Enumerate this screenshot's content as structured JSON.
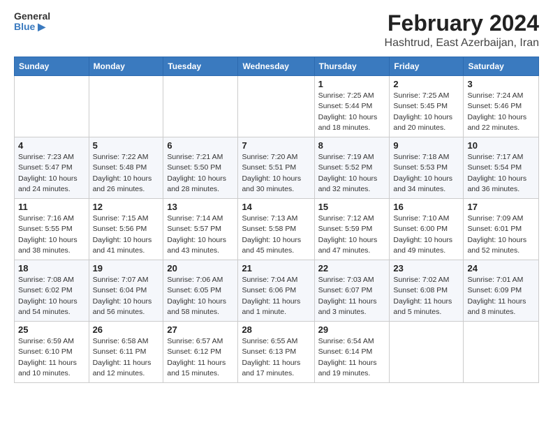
{
  "logo": {
    "general": "General",
    "blue": "Blue"
  },
  "header": {
    "title": "February 2024",
    "subtitle": "Hashtrud, East Azerbaijan, Iran"
  },
  "days_of_week": [
    "Sunday",
    "Monday",
    "Tuesday",
    "Wednesday",
    "Thursday",
    "Friday",
    "Saturday"
  ],
  "weeks": [
    [
      {
        "day": "",
        "detail": ""
      },
      {
        "day": "",
        "detail": ""
      },
      {
        "day": "",
        "detail": ""
      },
      {
        "day": "",
        "detail": ""
      },
      {
        "day": "1",
        "detail": "Sunrise: 7:25 AM\nSunset: 5:44 PM\nDaylight: 10 hours\nand 18 minutes."
      },
      {
        "day": "2",
        "detail": "Sunrise: 7:25 AM\nSunset: 5:45 PM\nDaylight: 10 hours\nand 20 minutes."
      },
      {
        "day": "3",
        "detail": "Sunrise: 7:24 AM\nSunset: 5:46 PM\nDaylight: 10 hours\nand 22 minutes."
      }
    ],
    [
      {
        "day": "4",
        "detail": "Sunrise: 7:23 AM\nSunset: 5:47 PM\nDaylight: 10 hours\nand 24 minutes."
      },
      {
        "day": "5",
        "detail": "Sunrise: 7:22 AM\nSunset: 5:48 PM\nDaylight: 10 hours\nand 26 minutes."
      },
      {
        "day": "6",
        "detail": "Sunrise: 7:21 AM\nSunset: 5:50 PM\nDaylight: 10 hours\nand 28 minutes."
      },
      {
        "day": "7",
        "detail": "Sunrise: 7:20 AM\nSunset: 5:51 PM\nDaylight: 10 hours\nand 30 minutes."
      },
      {
        "day": "8",
        "detail": "Sunrise: 7:19 AM\nSunset: 5:52 PM\nDaylight: 10 hours\nand 32 minutes."
      },
      {
        "day": "9",
        "detail": "Sunrise: 7:18 AM\nSunset: 5:53 PM\nDaylight: 10 hours\nand 34 minutes."
      },
      {
        "day": "10",
        "detail": "Sunrise: 7:17 AM\nSunset: 5:54 PM\nDaylight: 10 hours\nand 36 minutes."
      }
    ],
    [
      {
        "day": "11",
        "detail": "Sunrise: 7:16 AM\nSunset: 5:55 PM\nDaylight: 10 hours\nand 38 minutes."
      },
      {
        "day": "12",
        "detail": "Sunrise: 7:15 AM\nSunset: 5:56 PM\nDaylight: 10 hours\nand 41 minutes."
      },
      {
        "day": "13",
        "detail": "Sunrise: 7:14 AM\nSunset: 5:57 PM\nDaylight: 10 hours\nand 43 minutes."
      },
      {
        "day": "14",
        "detail": "Sunrise: 7:13 AM\nSunset: 5:58 PM\nDaylight: 10 hours\nand 45 minutes."
      },
      {
        "day": "15",
        "detail": "Sunrise: 7:12 AM\nSunset: 5:59 PM\nDaylight: 10 hours\nand 47 minutes."
      },
      {
        "day": "16",
        "detail": "Sunrise: 7:10 AM\nSunset: 6:00 PM\nDaylight: 10 hours\nand 49 minutes."
      },
      {
        "day": "17",
        "detail": "Sunrise: 7:09 AM\nSunset: 6:01 PM\nDaylight: 10 hours\nand 52 minutes."
      }
    ],
    [
      {
        "day": "18",
        "detail": "Sunrise: 7:08 AM\nSunset: 6:02 PM\nDaylight: 10 hours\nand 54 minutes."
      },
      {
        "day": "19",
        "detail": "Sunrise: 7:07 AM\nSunset: 6:04 PM\nDaylight: 10 hours\nand 56 minutes."
      },
      {
        "day": "20",
        "detail": "Sunrise: 7:06 AM\nSunset: 6:05 PM\nDaylight: 10 hours\nand 58 minutes."
      },
      {
        "day": "21",
        "detail": "Sunrise: 7:04 AM\nSunset: 6:06 PM\nDaylight: 11 hours\nand 1 minute."
      },
      {
        "day": "22",
        "detail": "Sunrise: 7:03 AM\nSunset: 6:07 PM\nDaylight: 11 hours\nand 3 minutes."
      },
      {
        "day": "23",
        "detail": "Sunrise: 7:02 AM\nSunset: 6:08 PM\nDaylight: 11 hours\nand 5 minutes."
      },
      {
        "day": "24",
        "detail": "Sunrise: 7:01 AM\nSunset: 6:09 PM\nDaylight: 11 hours\nand 8 minutes."
      }
    ],
    [
      {
        "day": "25",
        "detail": "Sunrise: 6:59 AM\nSunset: 6:10 PM\nDaylight: 11 hours\nand 10 minutes."
      },
      {
        "day": "26",
        "detail": "Sunrise: 6:58 AM\nSunset: 6:11 PM\nDaylight: 11 hours\nand 12 minutes."
      },
      {
        "day": "27",
        "detail": "Sunrise: 6:57 AM\nSunset: 6:12 PM\nDaylight: 11 hours\nand 15 minutes."
      },
      {
        "day": "28",
        "detail": "Sunrise: 6:55 AM\nSunset: 6:13 PM\nDaylight: 11 hours\nand 17 minutes."
      },
      {
        "day": "29",
        "detail": "Sunrise: 6:54 AM\nSunset: 6:14 PM\nDaylight: 11 hours\nand 19 minutes."
      },
      {
        "day": "",
        "detail": ""
      },
      {
        "day": "",
        "detail": ""
      }
    ]
  ]
}
